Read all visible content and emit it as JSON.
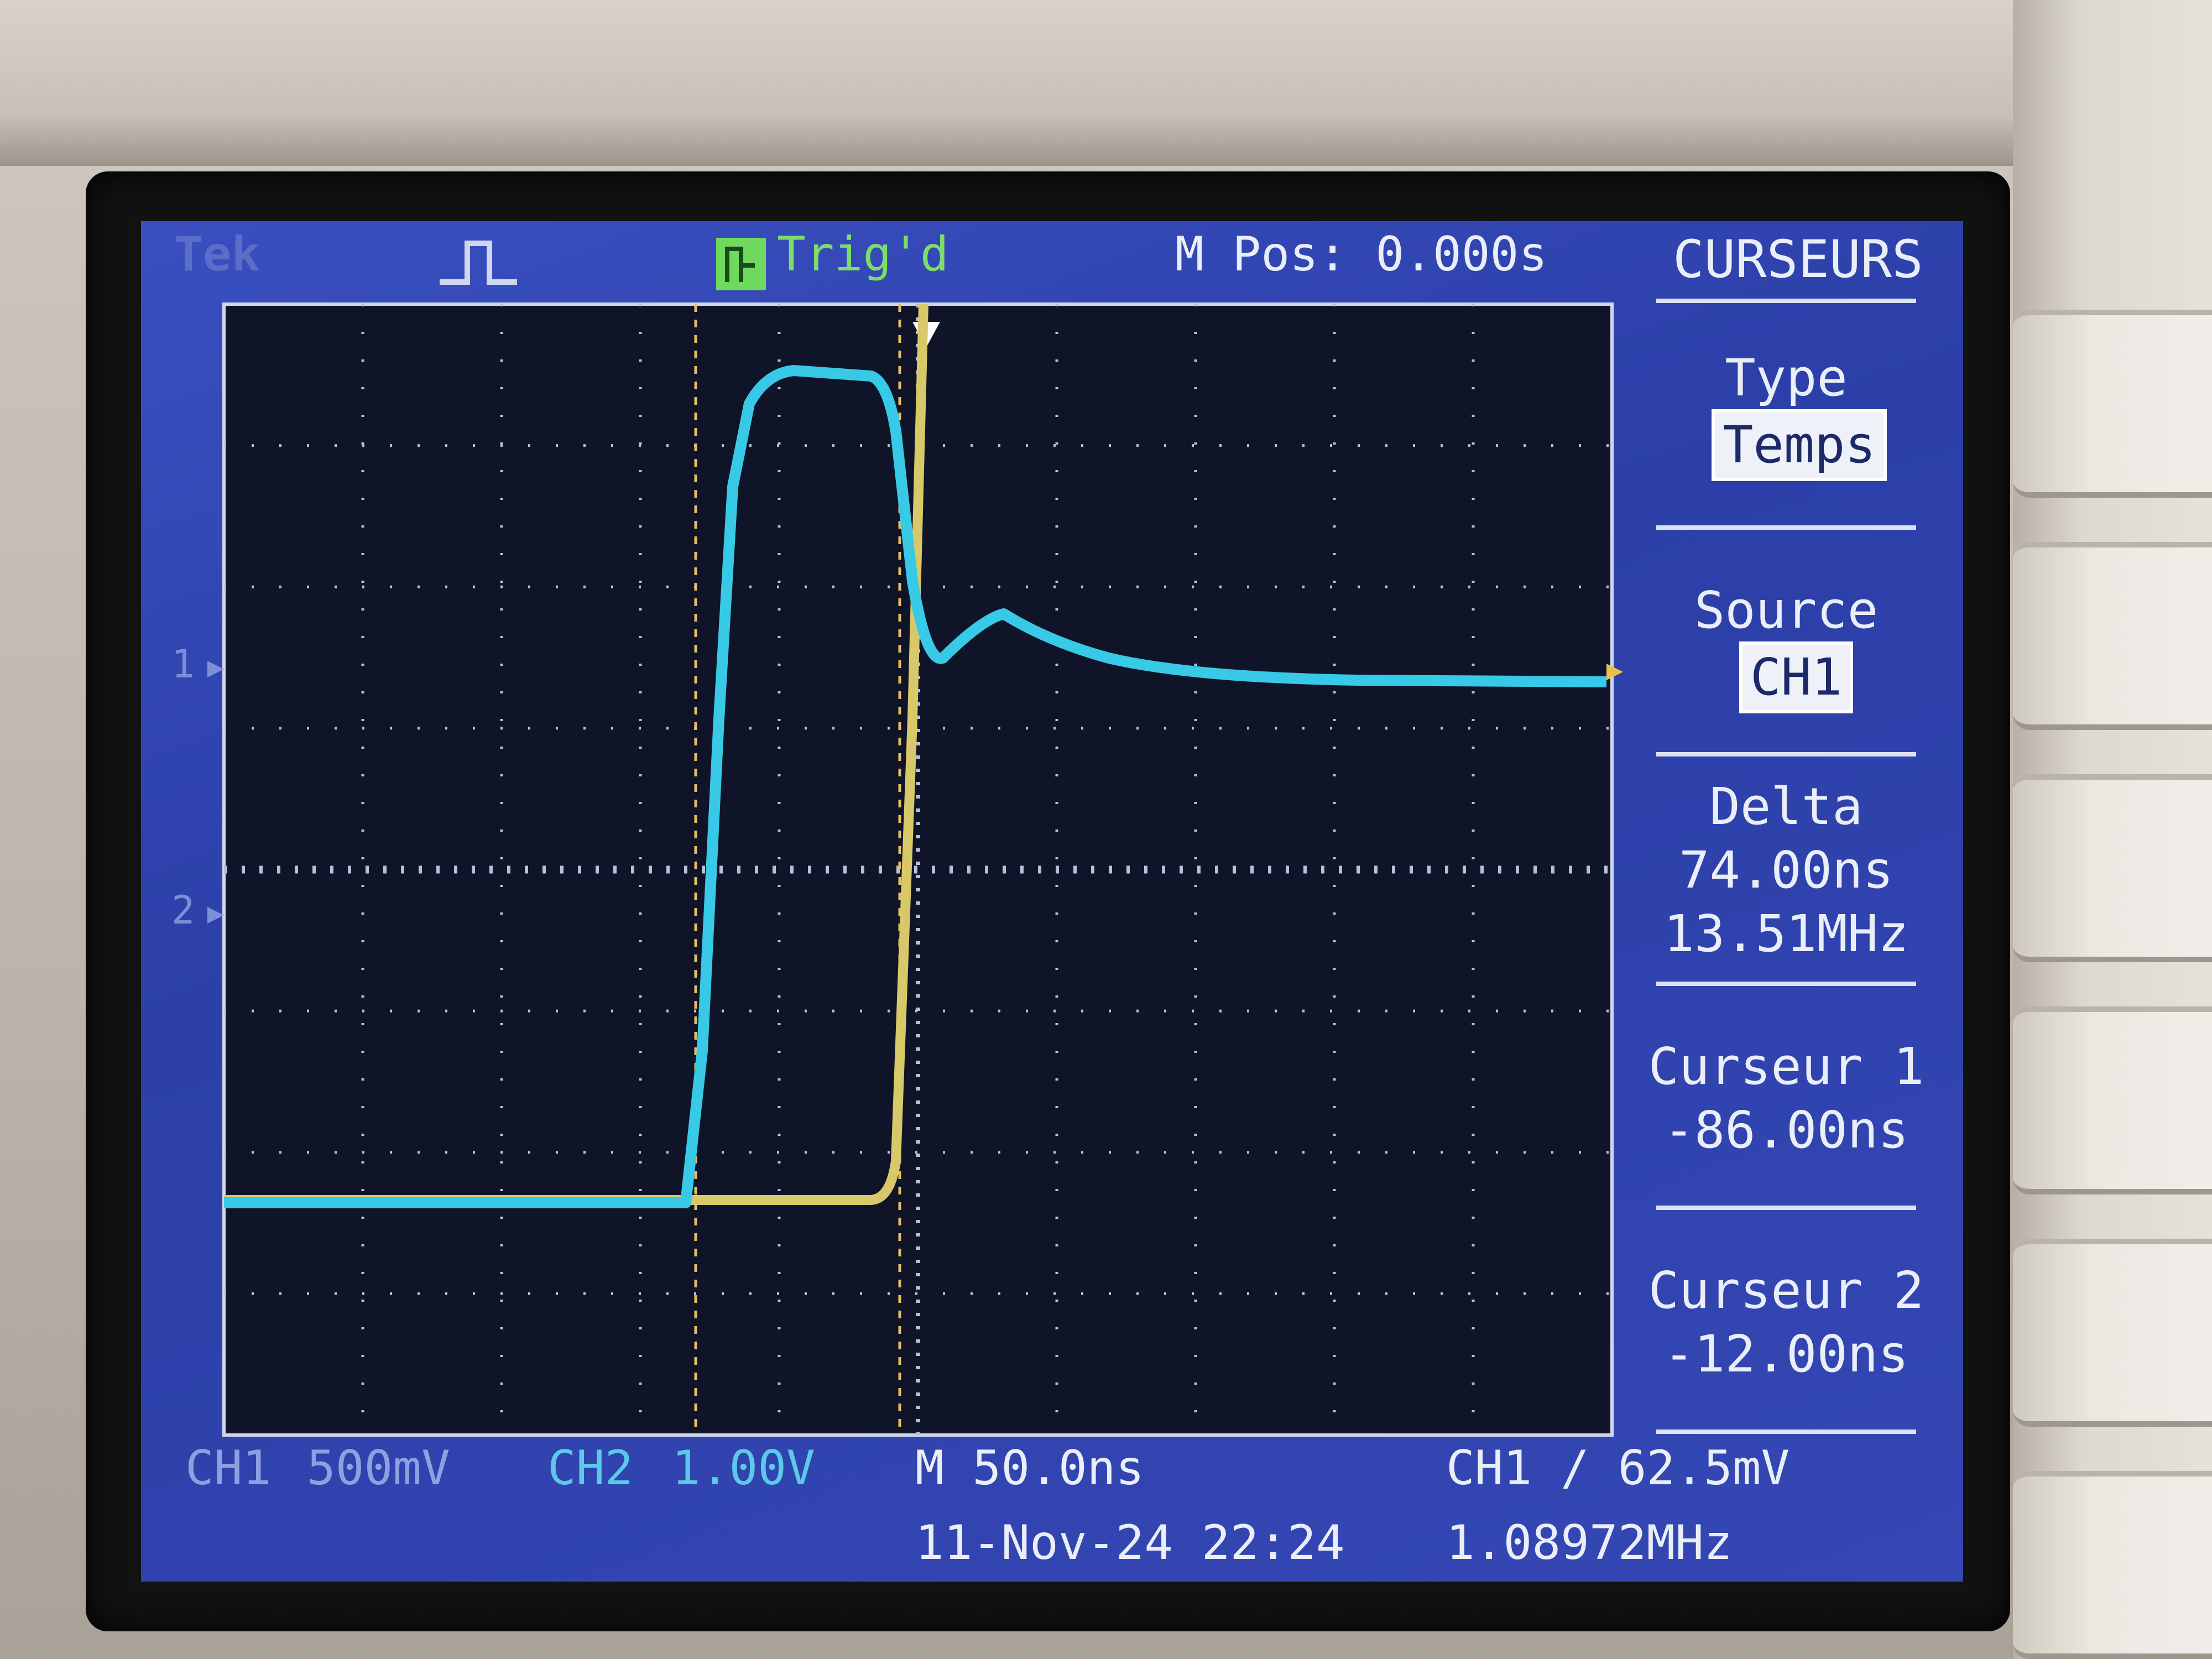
{
  "header": {
    "brand": "Tek",
    "trigger_state": "Trig'd",
    "main_position": "M Pos: 0.000s"
  },
  "menu": {
    "title": "CURSEURS",
    "items": [
      {
        "label": "Type",
        "value": "Temps"
      },
      {
        "label": "Source",
        "value": "CH1"
      },
      {
        "label": "Delta",
        "value": "74.00ns",
        "value2": "13.51MHz"
      },
      {
        "label": "Curseur 1",
        "value": "-86.00ns"
      },
      {
        "label": "Curseur 2",
        "value": "-12.00ns"
      }
    ]
  },
  "markers": {
    "ch1": "1",
    "ch2": "2"
  },
  "footer": {
    "ch1_label": "CH1",
    "ch1_scale": "500mV",
    "ch2_label": "CH2",
    "ch2_scale": "1.00V",
    "timebase": "M 50.0ns",
    "datetime": "11-Nov-24 22:24",
    "trigger": "CH1 / 62.5mV",
    "frequency": "1.08972MHz"
  },
  "colors": {
    "ch1_trace": "#38c9e6",
    "ch2_trace": "#d8c86a",
    "cursor": "#e0c060",
    "screen_bg": "#101428",
    "panel_bg": "#2f42b0",
    "trig_green": "#7ddc6a"
  },
  "icons": {
    "acq_icon": "pulse-waveform-icon",
    "trig_icon": "trigger-status-icon",
    "trigger_marker": "trigger-position-arrow-icon"
  }
}
